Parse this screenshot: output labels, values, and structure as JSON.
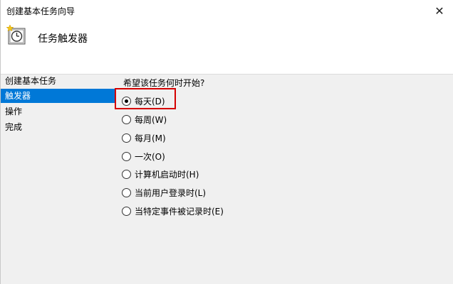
{
  "window": {
    "title": "创建基本任务向导",
    "close_glyph": "✕"
  },
  "header": {
    "title": "任务触发器",
    "icon": "task-clock-icon"
  },
  "sidebar": {
    "items": [
      {
        "label": "创建基本任务",
        "active": false
      },
      {
        "label": "触发器",
        "active": true
      },
      {
        "label": "操作",
        "active": false
      },
      {
        "label": "完成",
        "active": false
      }
    ]
  },
  "content": {
    "question": "希望该任务何时开始?",
    "options": [
      {
        "label": "每天(D)",
        "checked": true
      },
      {
        "label": "每周(W)",
        "checked": false
      },
      {
        "label": "每月(M)",
        "checked": false
      },
      {
        "label": "一次(O)",
        "checked": false
      },
      {
        "label": "计算机启动时(H)",
        "checked": false
      },
      {
        "label": "当前用户登录时(L)",
        "checked": false
      },
      {
        "label": "当特定事件被记录时(E)",
        "checked": false
      }
    ]
  },
  "colors": {
    "accent": "#0078d7",
    "highlight": "#d40000"
  }
}
